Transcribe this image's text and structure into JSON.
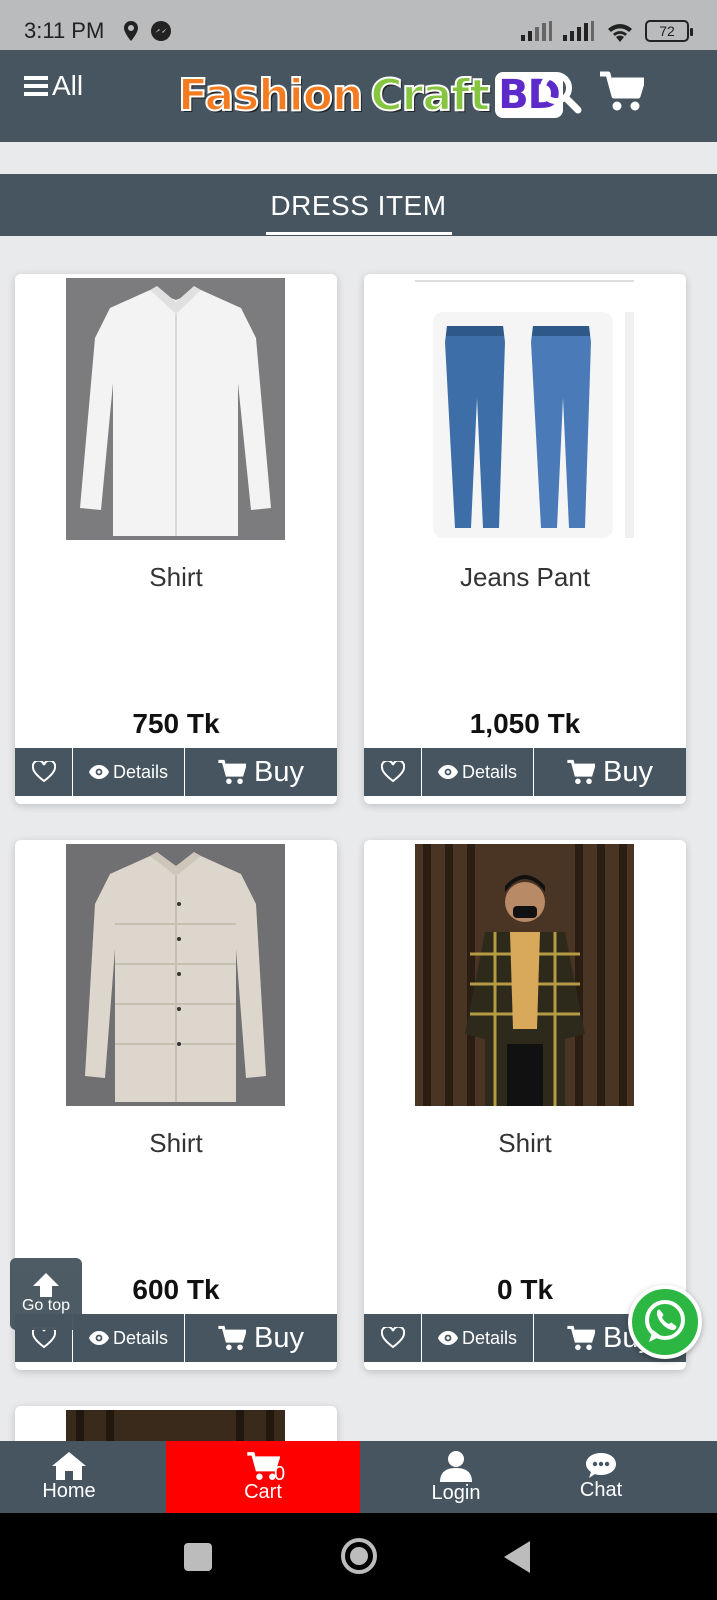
{
  "status_bar": {
    "time": "3:11 PM",
    "battery": "72"
  },
  "header": {
    "menu_label": "All",
    "logo": {
      "word1": "Fashion",
      "word2": "Craft",
      "word3": "BD"
    }
  },
  "section": {
    "title": "DRESS ITEM"
  },
  "products": [
    {
      "name": "Shirt",
      "price": "750 Tk",
      "details_label": "Details",
      "buy_label": "Buy"
    },
    {
      "name": "Jeans Pant",
      "price": "1,050 Tk",
      "details_label": "Details",
      "buy_label": "Buy"
    },
    {
      "name": "Shirt",
      "price": "600 Tk",
      "details_label": "Details",
      "buy_label": "Buy"
    },
    {
      "name": "Shirt",
      "price": "0 Tk",
      "details_label": "Details",
      "buy_label": "Buy"
    }
  ],
  "floating": {
    "go_top_label": "Go top"
  },
  "bottom_nav": {
    "home": "Home",
    "cart": "Cart",
    "cart_count": "0",
    "login": "Login",
    "chat": "Chat"
  },
  "colors": {
    "header_bg": "#46555f",
    "cart_bg": "#ff0000",
    "page_bg": "#e9eaec",
    "whatsapp": "#2bb741"
  }
}
